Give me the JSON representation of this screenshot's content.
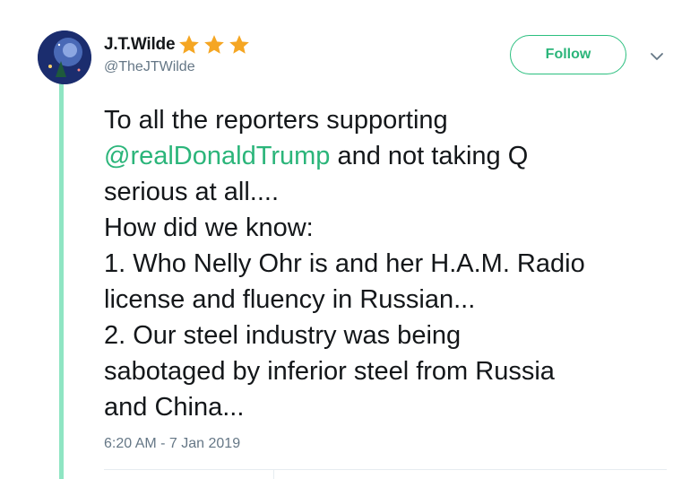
{
  "author": {
    "display_name": "J.T.Wilde",
    "badges": [
      "star-icon",
      "star-icon",
      "star-icon"
    ],
    "handle": "@TheJTWilde",
    "avatar_icon": "avatar-icon"
  },
  "actions": {
    "follow_label": "Follow",
    "menu_icon": "chevron-down-icon"
  },
  "tweet": {
    "lines": [
      {
        "text": "To all the reporters supporting"
      },
      {
        "mention": "@realDonaldTrump",
        "text": " and not taking Q"
      },
      {
        "text": "serious at all...."
      },
      {
        "text": "How did we know:"
      },
      {
        "text": "1. Who Nelly Ohr is and her H.A.M. Radio"
      },
      {
        "text": "license and fluency in Russian..."
      },
      {
        "text": "2. Our steel industry was being"
      },
      {
        "text": "sabotaged by inferior steel from Russia"
      },
      {
        "text": "and China..."
      }
    ],
    "timestamp": "6:20 AM - 7 Jan 2019"
  },
  "colors": {
    "accent": "#2bb57a",
    "thread_line": "#8fe5c3",
    "star": "#f5a623",
    "muted": "#657786"
  }
}
